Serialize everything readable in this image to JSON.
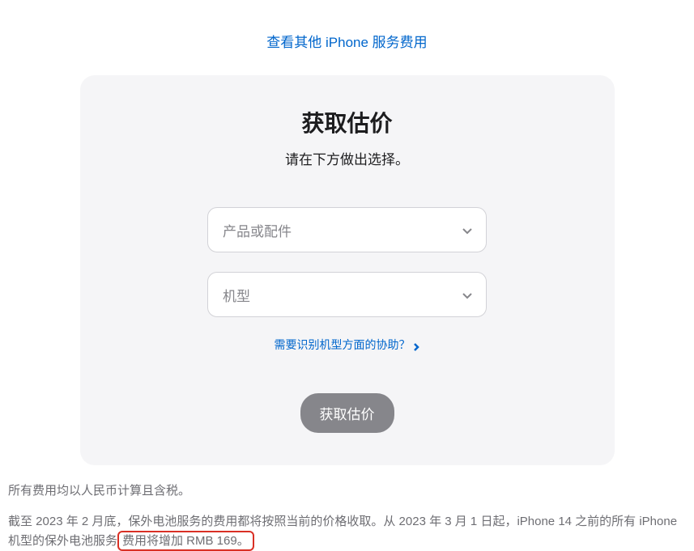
{
  "topLink": {
    "label": "查看其他 iPhone 服务费用"
  },
  "card": {
    "title": "获取估价",
    "subtitle": "请在下方做出选择。",
    "productSelect": {
      "placeholder": "产品或配件"
    },
    "modelSelect": {
      "placeholder": "机型"
    },
    "helpLink": {
      "label": "需要识别机型方面的协助？"
    },
    "button": {
      "label": "获取估价"
    }
  },
  "footer": {
    "line1": "所有费用均以人民币计算且含税。",
    "line2_part1": "截至 2023 年 2 月底，保外电池服务的费用都将按照当前的价格收取。从 2023 年 3 月 1 日起，iPhone 14 之前的所有 iPhone 机型的保外电池服务",
    "line2_highlight": "费用将增加 RMB 169。"
  }
}
